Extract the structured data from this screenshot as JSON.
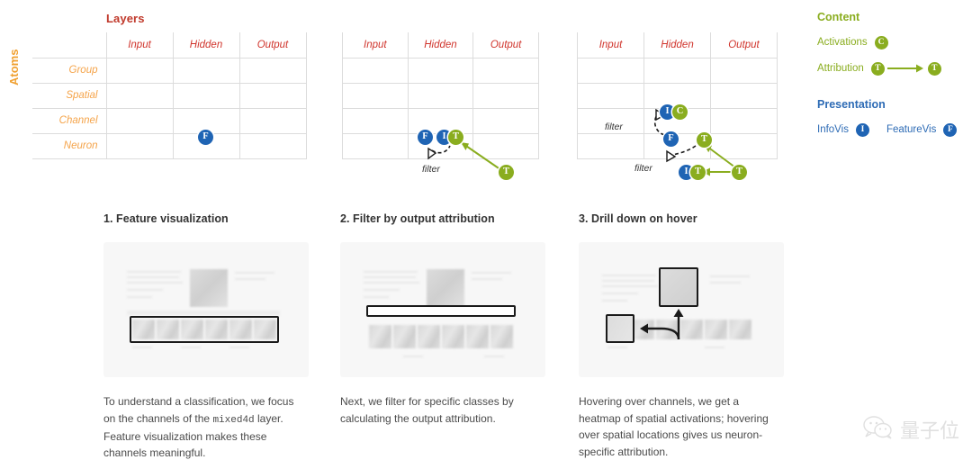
{
  "diagram": {
    "axis_title_columns": "Layers",
    "axis_title_rows": "Atoms",
    "columns": [
      "Input",
      "Hidden",
      "Output"
    ],
    "rows": [
      "Group",
      "Spatial",
      "Channel",
      "Neuron"
    ],
    "matrices": [
      {
        "id": "matrix-1",
        "badges": [
          {
            "label": "F",
            "kind": "featurevis",
            "color": "#1f64b4",
            "row": "Channel",
            "column": "Hidden"
          }
        ],
        "annotations": []
      },
      {
        "id": "matrix-2",
        "badges": [
          {
            "label": "F",
            "kind": "featurevis",
            "color": "#1f64b4",
            "row": "Channel",
            "column": "Hidden"
          },
          {
            "label": "I",
            "kind": "infovis",
            "color": "#1f64b4",
            "row": "Channel",
            "column": "Hidden"
          },
          {
            "label": "T",
            "kind": "attribution",
            "color": "#8aad1f",
            "row": "Channel",
            "column": "Hidden"
          },
          {
            "label": "T",
            "kind": "attribution",
            "color": "#8aad1f",
            "row": "Neuron",
            "column": "Output"
          }
        ],
        "annotations": [
          "filter"
        ]
      },
      {
        "id": "matrix-3",
        "badges": [
          {
            "label": "I",
            "kind": "infovis",
            "color": "#1f64b4",
            "row": "Spatial",
            "column": "Hidden"
          },
          {
            "label": "C",
            "kind": "activations",
            "color": "#8aad1f",
            "row": "Spatial",
            "column": "Hidden"
          },
          {
            "label": "F",
            "kind": "featurevis",
            "color": "#1f64b4",
            "row": "Channel",
            "column": "Hidden"
          },
          {
            "label": "T",
            "kind": "attribution",
            "color": "#8aad1f",
            "row": "Channel",
            "column": "Output"
          },
          {
            "label": "I",
            "kind": "infovis",
            "color": "#1f64b4",
            "row": "Neuron",
            "column": "Hidden"
          },
          {
            "label": "T",
            "kind": "attribution",
            "color": "#8aad1f",
            "row": "Neuron",
            "column": "Hidden"
          },
          {
            "label": "T",
            "kind": "attribution",
            "color": "#8aad1f",
            "row": "Neuron",
            "column": "Output"
          }
        ],
        "annotations": [
          "filter",
          "filter"
        ]
      }
    ]
  },
  "legend": {
    "content": {
      "heading": "Content",
      "items": [
        {
          "label": "Activations",
          "badge": "C",
          "color": "#8aad1f",
          "has_arrow": false
        },
        {
          "label": "Attribution",
          "badge": "T",
          "badge2": "T",
          "color": "#8aad1f",
          "has_arrow": true
        }
      ]
    },
    "presentation": {
      "heading": "Presentation",
      "items": [
        {
          "label": "InfoVis",
          "badge": "I",
          "color": "#1f64b4"
        },
        {
          "label": "FeatureVis",
          "badge": "F",
          "color": "#1f64b4"
        }
      ]
    }
  },
  "cards": [
    {
      "title": "1. Feature visualization",
      "body_before": "To understand a classification, we focus on the channels of the ",
      "body_code": "mixed4d",
      "body_after": " layer. Feature visualization makes these channels meaningful."
    },
    {
      "title": "2. Filter by output attribution",
      "body": "Next, we filter for specific classes by calculating the output attribution."
    },
    {
      "title": "3. Drill down on hover",
      "body": "Hovering over channels, we get a heatmap of spatial activations; hovering over spatial locations gives us neuron-specific attribution."
    }
  ],
  "watermark": {
    "text": "量子位",
    "icon": "wechat-icon"
  },
  "colors": {
    "layers_title": "#c0392b",
    "column_header": "#d0342c",
    "atoms_title": "#f0a030",
    "row_label": "#f5a44a",
    "blue_badge": "#1f64b4",
    "green_badge": "#8aad1f",
    "presentation_heading": "#2d6bb5"
  }
}
